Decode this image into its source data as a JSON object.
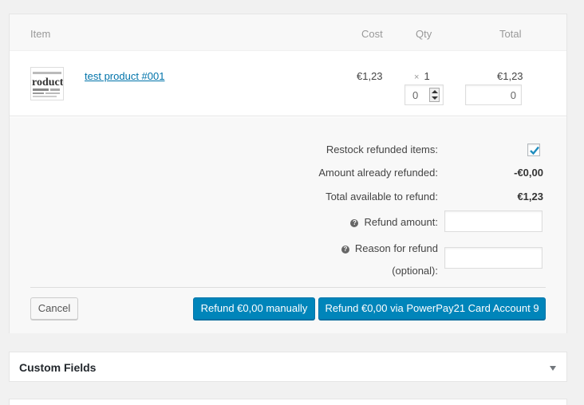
{
  "table": {
    "headers": {
      "item": "Item",
      "cost": "Cost",
      "qty": "Qty",
      "total": "Total"
    },
    "rows": [
      {
        "thumb_text": "roduct",
        "name": "test product #001",
        "cost": "€1,23",
        "qty_prefix": "×",
        "qty": "1",
        "refund_qty": "0",
        "total": "€1,23",
        "refund_total": "0"
      }
    ]
  },
  "refund": {
    "restock_label": "Restock refunded items:",
    "restock_checked": true,
    "already_label": "Amount already refunded:",
    "already_value": "-€0,00",
    "available_label": "Total available to refund:",
    "available_value": "€1,23",
    "amount_label": "Refund amount:",
    "amount_value": "",
    "reason_label_1": "Reason for refund",
    "reason_label_2": "(optional):",
    "reason_value": "",
    "help_glyph": "?"
  },
  "buttons": {
    "cancel": "Cancel",
    "manual": "Refund €0,00 manually",
    "gateway": "Refund €0,00 via PowerPay21 Card Account 9"
  },
  "custom_fields": {
    "title": "Custom Fields",
    "toggle_icon": "chevron-down-icon"
  },
  "colors": {
    "primary": "#0085ba",
    "link": "#0073aa",
    "check": "#1e8cbe"
  }
}
